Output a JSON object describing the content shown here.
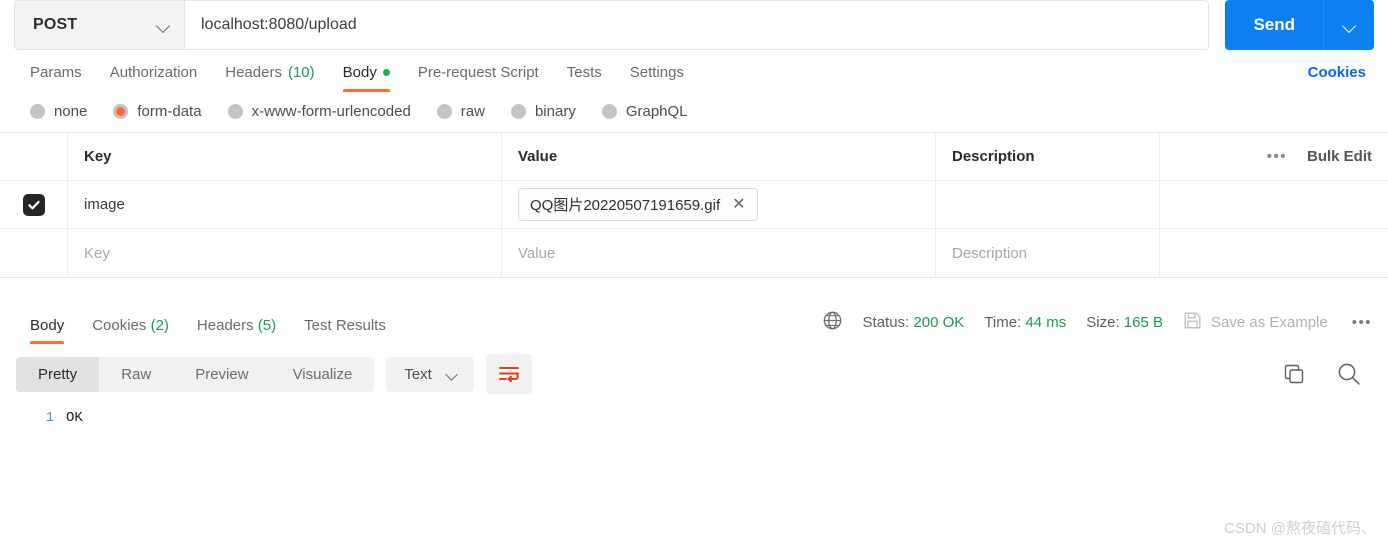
{
  "request": {
    "method": "POST",
    "url": "localhost:8080/upload",
    "send_label": "Send",
    "tabs": [
      {
        "label": "Params",
        "count": "",
        "active": false,
        "dot": false
      },
      {
        "label": "Authorization",
        "count": "",
        "active": false,
        "dot": false
      },
      {
        "label": "Headers",
        "count": "(10)",
        "active": false,
        "dot": false
      },
      {
        "label": "Body",
        "count": "",
        "active": true,
        "dot": true
      },
      {
        "label": "Pre-request Script",
        "count": "",
        "active": false,
        "dot": false
      },
      {
        "label": "Tests",
        "count": "",
        "active": false,
        "dot": false
      },
      {
        "label": "Settings",
        "count": "",
        "active": false,
        "dot": false
      }
    ],
    "cookies_link": "Cookies",
    "body_types": [
      {
        "label": "none",
        "checked": false
      },
      {
        "label": "form-data",
        "checked": true
      },
      {
        "label": "x-www-form-urlencoded",
        "checked": false
      },
      {
        "label": "raw",
        "checked": false
      },
      {
        "label": "binary",
        "checked": false
      },
      {
        "label": "GraphQL",
        "checked": false
      }
    ],
    "table": {
      "headers": {
        "key": "Key",
        "value": "Value",
        "description": "Description"
      },
      "bulk_edit": "Bulk Edit",
      "more_dots": "•••",
      "rows": [
        {
          "checked": true,
          "key": "image",
          "value_file": "QQ图片20220507191659.gif",
          "description": ""
        }
      ],
      "placeholder_row": {
        "key": "Key",
        "value": "Value",
        "description": "Description"
      }
    }
  },
  "response": {
    "tabs": [
      {
        "label": "Body",
        "count": "",
        "active": true
      },
      {
        "label": "Cookies",
        "count": "(2)",
        "active": false
      },
      {
        "label": "Headers",
        "count": "(5)",
        "active": false
      },
      {
        "label": "Test Results",
        "count": "",
        "active": false
      }
    ],
    "status_label": "Status:",
    "status_value": "200 OK",
    "time_label": "Time:",
    "time_value": "44 ms",
    "size_label": "Size:",
    "size_value": "165 B",
    "save_example": "Save as Example",
    "more_dots": "•••",
    "viewer": {
      "modes": [
        {
          "label": "Pretty",
          "active": true
        },
        {
          "label": "Raw",
          "active": false
        },
        {
          "label": "Preview",
          "active": false
        },
        {
          "label": "Visualize",
          "active": false
        }
      ],
      "type": "Text"
    },
    "body_lines": [
      {
        "num": "1",
        "text": "OK"
      }
    ]
  },
  "watermark": "CSDN @熬夜磕代码、",
  "colors": {
    "accent": "#ff6c37",
    "send_blue": "#0c7ff2",
    "link_blue": "#0c68e9",
    "success_green": "#1a9b55"
  }
}
